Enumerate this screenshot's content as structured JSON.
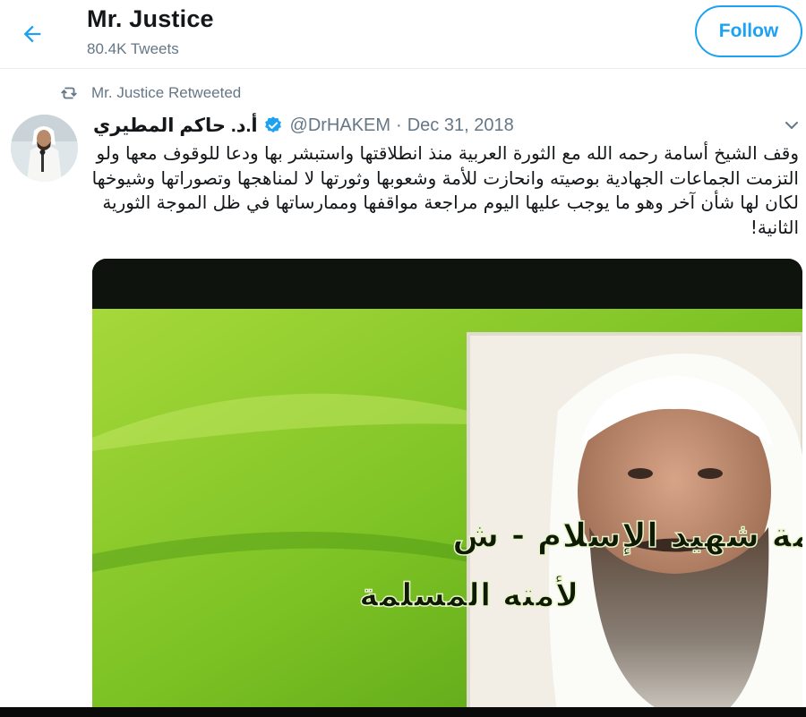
{
  "header": {
    "title": "Mr. Justice",
    "subtitle": "80.4K Tweets",
    "follow_label": "Follow"
  },
  "retweet": {
    "label": "Mr. Justice Retweeted"
  },
  "tweet": {
    "author_name": "أ.د. حاكم المطيري",
    "handle": "@DrHAKEM",
    "separator": "·",
    "date": "Dec 31, 2018",
    "text": "وقف الشيخ أسامة رحمه الله مع الثورة العربية منذ انطلاقتها واستبشر بها ودعا للوقوف معها ولو التزمت الجماعات الجهادية بوصيته وانحازت للأمة وشعوبها وثورتها لا لمناهجها وتصوراتها وشيوخها لكان لها شأن آخر وهو ما يوجب عليها اليوم مراجعة مواقفها وممارساتها في ظل الموجة الثورية الثانية!",
    "media": {
      "caption_line1": "كلمة شهيد الإسلام - ش",
      "caption_line2": "لأمته المسلمة"
    }
  },
  "colors": {
    "accent": "#1da1f2",
    "secondary_text": "#657786",
    "primary_text": "#14171a",
    "media_green": "#7fc22a"
  },
  "icons": [
    "back-arrow-icon",
    "retweet-icon",
    "verified-badge-icon",
    "chevron-down-icon"
  ]
}
